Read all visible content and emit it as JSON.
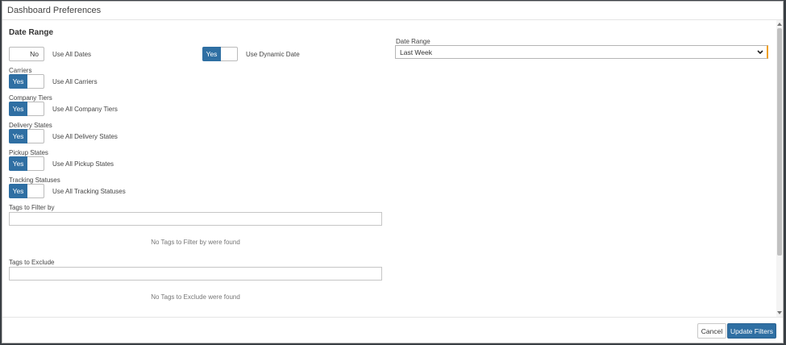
{
  "modal": {
    "title": "Dashboard Preferences",
    "section_title": "Date Range"
  },
  "toggles": {
    "use_all_dates": {
      "state": "No",
      "label": "Use All Dates"
    },
    "use_dynamic_date": {
      "state": "Yes",
      "label": "Use Dynamic Date"
    },
    "carriers": {
      "title": "Carriers",
      "state": "Yes",
      "label": "Use All Carriers"
    },
    "company_tiers": {
      "title": "Company Tiers",
      "state": "Yes",
      "label": "Use All Company Tiers"
    },
    "delivery_states": {
      "title": "Delivery States",
      "state": "Yes",
      "label": "Use All Delivery States"
    },
    "pickup_states": {
      "title": "Pickup States",
      "state": "Yes",
      "label": "Use All Pickup States"
    },
    "tracking_statuses": {
      "title": "Tracking Statuses",
      "state": "Yes",
      "label": "Use All Tracking Statuses"
    }
  },
  "date_range": {
    "label": "Date Range",
    "selected": "Last Week"
  },
  "tags_filter": {
    "label": "Tags to Filter by",
    "value": "",
    "empty_message": "No Tags to Filter by were found"
  },
  "tags_exclude": {
    "label": "Tags to Exclude",
    "value": "",
    "empty_message": "No Tags to Exclude were found"
  },
  "footer": {
    "cancel_label": "Cancel",
    "update_label": "Update Filters"
  },
  "colors": {
    "primary": "#2f6fa3",
    "select_accent": "#f0a020"
  }
}
